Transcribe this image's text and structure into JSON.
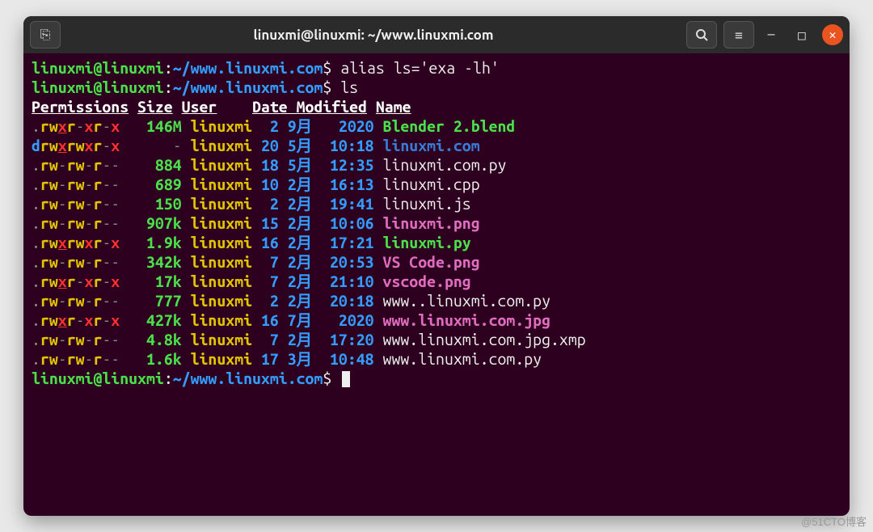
{
  "window": {
    "title": "linuxmi@linuxmi: ~/www.linuxmi.com",
    "new_tab_icon": "⎘",
    "search_icon": "Q",
    "menu_icon": "≡",
    "min_icon": "—",
    "max_icon": "□",
    "close_icon": "✕"
  },
  "prompt": {
    "user_host": "linuxmi@linuxmi",
    "sep": ":",
    "path": "~/www.linuxmi.com",
    "sigil": "$"
  },
  "commands": {
    "alias": "alias ls='exa -lh'",
    "ls": "ls"
  },
  "headers": {
    "perm": "Permissions",
    "size": "Size",
    "user": "User",
    "date": "Date Modified",
    "name": "Name"
  },
  "rows": [
    {
      "type": ".",
      "ur": "rw",
      "ux": "x",
      "gr": "r",
      "gw": "-",
      "gx": "x",
      "or": "r",
      "ow": "-",
      "ox": "x",
      "size": "146M",
      "user": "linuxmi",
      "d": " 2",
      "m": "9月",
      "t": " 2020",
      "name": "Blender 2.blend",
      "nameClass": "gb"
    },
    {
      "type": "d",
      "ur": "rw",
      "ux": "x",
      "gr": "r",
      "gw": "w",
      "gx": "x",
      "or": "r",
      "ow": "-",
      "ox": "x",
      "size": "-",
      "user": "linuxmi",
      "d": "20",
      "m": "5月",
      "t": "10:18",
      "name": "linuxmi.com",
      "nameClass": "blb"
    },
    {
      "type": ".",
      "ur": "rw",
      "ux": "-",
      "gr": "r",
      "gw": "w",
      "gx": "-",
      "or": "r",
      "ow": "-",
      "ox": "-",
      "size": "884",
      "user": "linuxmi",
      "d": "18",
      "m": "5月",
      "t": "12:35",
      "name": "linuxmi.com.py",
      "nameClass": "w"
    },
    {
      "type": ".",
      "ur": "rw",
      "ux": "-",
      "gr": "r",
      "gw": "w",
      "gx": "-",
      "or": "r",
      "ow": "-",
      "ox": "-",
      "size": "689",
      "user": "linuxmi",
      "d": "10",
      "m": "2月",
      "t": "16:13",
      "name": "linuxmi.cpp",
      "nameClass": "w"
    },
    {
      "type": ".",
      "ur": "rw",
      "ux": "-",
      "gr": "r",
      "gw": "w",
      "gx": "-",
      "or": "r",
      "ow": "-",
      "ox": "-",
      "size": "150",
      "user": "linuxmi",
      "d": " 2",
      "m": "2月",
      "t": "19:41",
      "name": "linuxmi.js",
      "nameClass": "w"
    },
    {
      "type": ".",
      "ur": "rw",
      "ux": "-",
      "gr": "r",
      "gw": "w",
      "gx": "-",
      "or": "r",
      "ow": "-",
      "ox": "-",
      "size": "907k",
      "user": "linuxmi",
      "d": "15",
      "m": "2月",
      "t": "10:06",
      "name": "linuxmi.png",
      "nameClass": "pk"
    },
    {
      "type": ".",
      "ur": "rw",
      "ux": "x",
      "gr": "r",
      "gw": "w",
      "gx": "x",
      "or": "r",
      "ow": "-",
      "ox": "x",
      "size": "1.9k",
      "user": "linuxmi",
      "d": "16",
      "m": "2月",
      "t": "17:21",
      "name": "linuxmi.py",
      "nameClass": "gb"
    },
    {
      "type": ".",
      "ur": "rw",
      "ux": "-",
      "gr": "r",
      "gw": "w",
      "gx": "-",
      "or": "r",
      "ow": "-",
      "ox": "-",
      "size": "342k",
      "user": "linuxmi",
      "d": " 7",
      "m": "2月",
      "t": "20:53",
      "name": "VS Code.png",
      "nameClass": "pk"
    },
    {
      "type": ".",
      "ur": "rw",
      "ux": "x",
      "gr": "r",
      "gw": "-",
      "gx": "x",
      "or": "r",
      "ow": "-",
      "ox": "x",
      "size": "17k",
      "user": "linuxmi",
      "d": " 7",
      "m": "2月",
      "t": "21:10",
      "name": "vscode.png",
      "nameClass": "pk"
    },
    {
      "type": ".",
      "ur": "rw",
      "ux": "-",
      "gr": "r",
      "gw": "w",
      "gx": "-",
      "or": "r",
      "ow": "-",
      "ox": "-",
      "size": "777",
      "user": "linuxmi",
      "d": " 2",
      "m": "2月",
      "t": "20:18",
      "name": "www..linuxmi.com.py",
      "nameClass": "w"
    },
    {
      "type": ".",
      "ur": "rw",
      "ux": "x",
      "gr": "r",
      "gw": "-",
      "gx": "x",
      "or": "r",
      "ow": "-",
      "ox": "x",
      "size": "427k",
      "user": "linuxmi",
      "d": "16",
      "m": "7月",
      "t": " 2020",
      "name": "www.linuxmi.com.jpg",
      "nameClass": "pk"
    },
    {
      "type": ".",
      "ur": "rw",
      "ux": "-",
      "gr": "r",
      "gw": "w",
      "gx": "-",
      "or": "r",
      "ow": "-",
      "ox": "-",
      "size": "4.8k",
      "user": "linuxmi",
      "d": " 7",
      "m": "2月",
      "t": "17:20",
      "name": "www.linuxmi.com.jpg.xmp",
      "nameClass": "w"
    },
    {
      "type": ".",
      "ur": "rw",
      "ux": "-",
      "gr": "r",
      "gw": "w",
      "gx": "-",
      "or": "r",
      "ow": "-",
      "ox": "-",
      "size": "1.6k",
      "user": "linuxmi",
      "d": "17",
      "m": "3月",
      "t": "10:48",
      "name": "www.linuxmi.com.py",
      "nameClass": "w"
    }
  ],
  "watermark": "@51CTO博客"
}
